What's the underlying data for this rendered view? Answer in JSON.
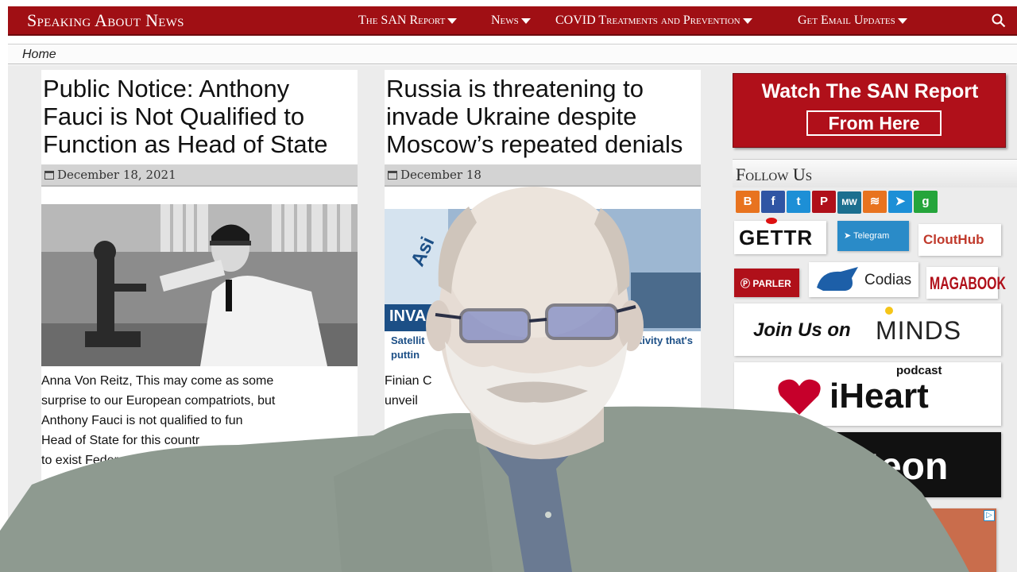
{
  "site": {
    "brand": "Speaking About News",
    "nav": [
      {
        "label": "The SAN Report",
        "has_caret": true
      },
      {
        "label": "News",
        "has_caret": true
      },
      {
        "label": "COVID Treatments and Prevention",
        "has_caret": true
      },
      {
        "label": "Get Email Updates",
        "has_caret": true
      }
    ],
    "breadcrumb": "Home"
  },
  "articles": [
    {
      "title": "Public Notice: Anthony Fauci is Not Qualified to Function as Head of State",
      "date": "December 18, 2021",
      "excerpt_lines": [
        "Anna Von Reitz, This may come as some",
        "surprise to our European compatriots, but",
        "Anthony Fauci is not qualified to fun",
        "Head of State for this countr",
        "to exist Feder"
      ]
    },
    {
      "title": "Russia is threatening to invade Ukraine despite Moscow’s repeated denials",
      "date": "December 18",
      "image_caption_tag": "INVA",
      "image_caption_line1": "Satellit",
      "image_caption_line1b": "tivity that's",
      "image_caption_line2": "puttin",
      "image_side_text": "Asi",
      "excerpt_lines": [
        "Finian C",
        "unveil"
      ]
    }
  ],
  "sidebar": {
    "san_banner_line1": "Watch The SAN Report",
    "san_banner_line2": "From Here",
    "follow_title": "Follow Us",
    "social_icons": [
      {
        "name": "blogger-icon",
        "glyph": "B",
        "color": "#e8731f"
      },
      {
        "name": "facebook-icon",
        "glyph": "f",
        "color": "#2f55a4"
      },
      {
        "name": "twitter-icon",
        "glyph": "t",
        "color": "#1d8fd6"
      },
      {
        "name": "parler-icon",
        "glyph": "P",
        "color": "#b0101a"
      },
      {
        "name": "mewe-icon",
        "glyph": "MW",
        "color": "#1c6f8f"
      },
      {
        "name": "rss-icon",
        "glyph": "≋",
        "color": "#e8731f"
      },
      {
        "name": "telegram-icon",
        "glyph": "➤",
        "color": "#1d8fd6"
      },
      {
        "name": "gab-icon",
        "glyph": "g",
        "color": "#25a53b"
      }
    ],
    "logos": {
      "gettr": "GETTR",
      "telegram": "Telegram",
      "clouthub": "CloutHub",
      "parler": "PARLER",
      "codias": "Codias",
      "magabook": "MAGABOOK",
      "minds_prefix": "Join Us on",
      "minds": "MINDS",
      "iheart_small": "podcast",
      "iheart": "iHeart",
      "brighteon": "ighteon"
    }
  },
  "colors": {
    "brand_red": "#a00f14",
    "banner_red": "#b0101a"
  }
}
